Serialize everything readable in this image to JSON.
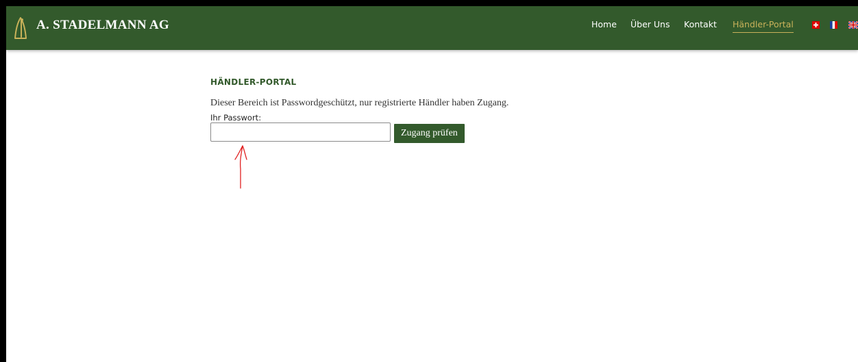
{
  "header": {
    "brand": "A. STADELMANN AG",
    "nav": [
      {
        "label": "Home",
        "active": false
      },
      {
        "label": "Über Uns",
        "active": false
      },
      {
        "label": "Kontakt",
        "active": false
      },
      {
        "label": "Händler-Portal",
        "active": true
      }
    ],
    "languages": [
      "swiss-flag-icon",
      "french-flag-icon",
      "uk-flag-icon"
    ]
  },
  "main": {
    "title": "HÄNDLER-PORTAL",
    "intro": "Dieser Bereich ist Passwordgeschützt, nur registrierte Händler haben Zugang.",
    "password_label": "Ihr Passwort:",
    "password_value": "",
    "submit_label": "Zugang prüfen"
  },
  "colors": {
    "brand_green": "#335a2c",
    "active_gold": "#c9b25a",
    "annotation_red": "#e02020"
  }
}
